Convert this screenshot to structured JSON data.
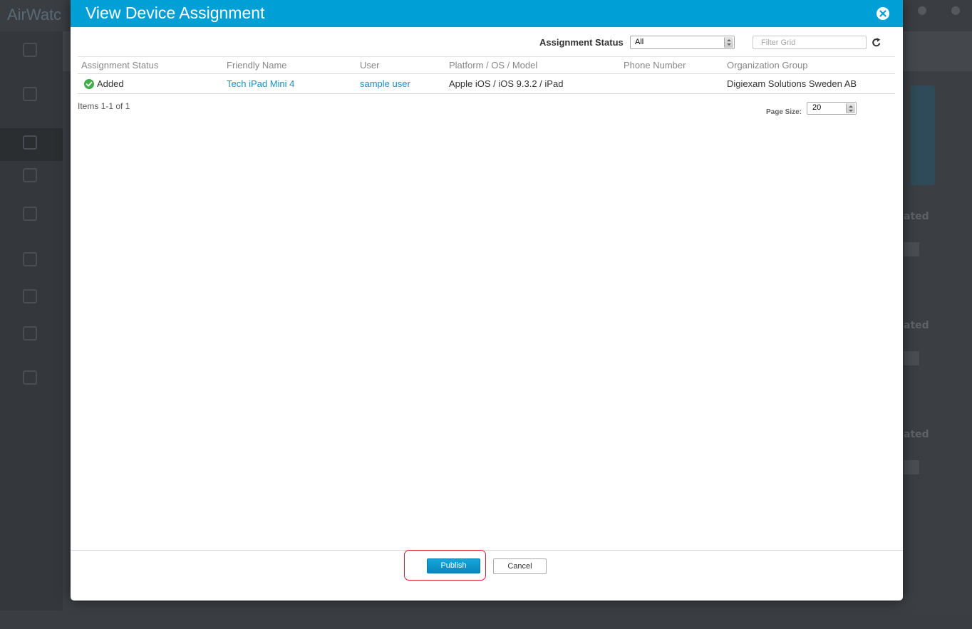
{
  "background_app": {
    "brand": "AirWatc",
    "panel_word": "ated"
  },
  "modal": {
    "title": "View Device Assignment",
    "toolbar": {
      "status_label": "Assignment Status",
      "status_value": "All",
      "filter_placeholder": "Filter Grid"
    },
    "grid": {
      "columns": [
        "Assignment Status",
        "Friendly Name",
        "User",
        "Platform / OS / Model",
        "Phone Number",
        "Organization Group"
      ],
      "rows": [
        {
          "status": "Added",
          "friendly_name": "Tech iPad Mini 4",
          "user": "sample user",
          "platform": "Apple iOS / iOS 9.3.2 / iPad",
          "phone": "",
          "org_group": "Digiexam Solutions Sweden AB"
        }
      ]
    },
    "items_count": "Items 1-1 of 1",
    "page_size_label": "Page Size:",
    "page_size_value": "20",
    "buttons": {
      "publish": "Publish",
      "cancel": "Cancel"
    }
  },
  "colors": {
    "header_blue": "#00a0d6",
    "link_blue": "#1a8fc0",
    "success_green": "#3fae49",
    "highlight_red": "#e0202a"
  }
}
